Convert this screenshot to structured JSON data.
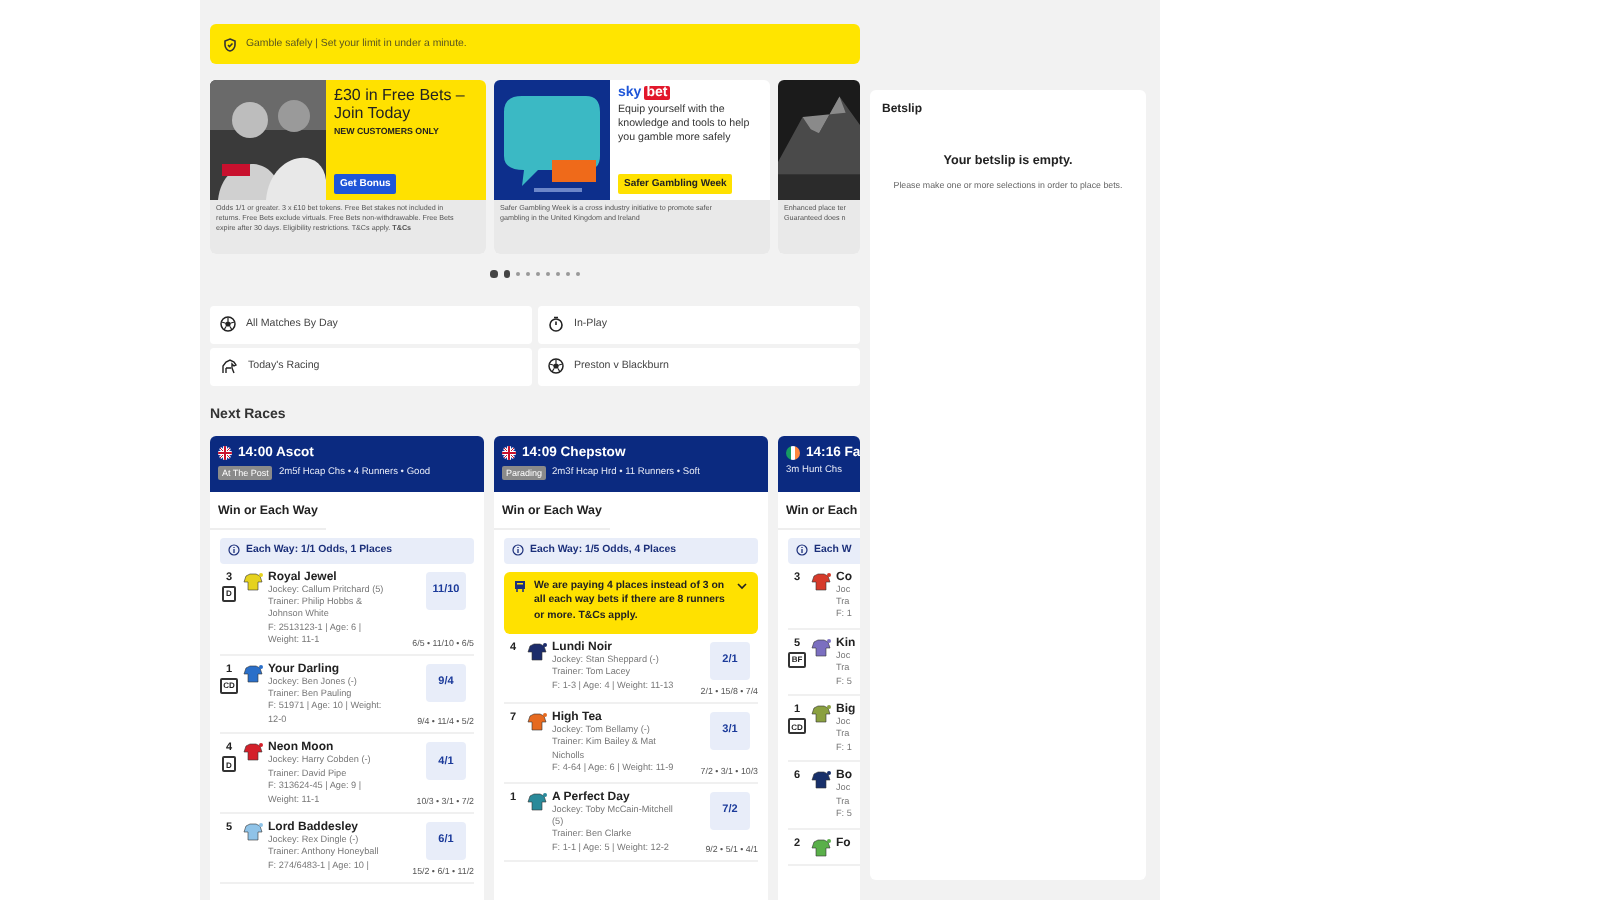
{
  "banner": {
    "text": "Gamble safely | Set your limit in under a minute."
  },
  "promos": [
    {
      "kind": "offer",
      "heading": "£30 in Free Bets – Join Today",
      "subheading": "NEW CUSTOMERS ONLY",
      "button": "Get Bonus",
      "footer": [
        "Odds 1/1 or greater. 3 x £10 bet tokens. Free Bet stakes not included in",
        "returns. Free Bets exclude virtuals. Free Bets non-withdrawable. Free Bets",
        "expire after 30 days. Eligibility restrictions. T&Cs apply. **T&Cs**"
      ]
    },
    {
      "kind": "info",
      "logo": {
        "first": "sky",
        "second": "bet"
      },
      "text": "Equip yourself with the knowledge and tools to help you gamble more safely",
      "button": "Safer Gambling Week",
      "footer": [
        "Safer Gambling Week is a cross industry initiative to promote safer",
        "gambling in the United Kingdom and Ireland"
      ]
    },
    {
      "footer": [
        "Enhanced place ter",
        "Guaranteed does n"
      ]
    }
  ],
  "carousel_dots": [
    {
      "selected": true
    },
    {
      "selected": true
    },
    {
      "selected": false
    },
    {
      "selected": false
    },
    {
      "selected": false
    },
    {
      "selected": false
    },
    {
      "selected": false
    },
    {
      "selected": false
    },
    {
      "selected": false
    }
  ],
  "quick_links": [
    {
      "kind": "ball",
      "label": "All Matches By Day"
    },
    {
      "kind": "stopwatch",
      "label": "In-Play"
    },
    {
      "kind": "horse",
      "label": "Today's Racing"
    },
    {
      "kind": "ball",
      "label": "Preston v Blackburn"
    }
  ],
  "next_races": {
    "title": "Next Races",
    "races": [
      {
        "kind": "uk",
        "title": "14:00 Ascot",
        "status": "At The Post",
        "info": "2m5f Hcap Chs • 4 Runners • Good",
        "market": "Win or Each Way",
        "each_way": "Each Way: 1/1 Odds, 1 Places",
        "runners": [
          {
            "number": "3",
            "badge": "D",
            "color": "#e6d21f",
            "name": "Royal Jewel",
            "jockey": "Jockey: Callum Pritchard (5)",
            "trainer": "Trainer: Philip Hobbs & Johnson White",
            "form": "F: 2513123-1 | Age: 6 | Weight: 11-1",
            "odds": "11/10",
            "history": "6/5 • 11/10 • 6/5"
          },
          {
            "number": "1",
            "badge": "CD",
            "color": "#2a6fc9",
            "name": "Your Darling",
            "jockey": "Jockey: Ben Jones (-)",
            "trainer": "Trainer: Ben Pauling",
            "form": "F: 51971 | Age: 10 | Weight: 12-0",
            "odds": "9/4",
            "history": "9/4 • 11/4 • 5/2"
          },
          {
            "number": "4",
            "badge": "D",
            "color": "#d4202a",
            "name": "Neon Moon",
            "jockey": "Jockey: Harry Cobden (-)",
            "trainer": "Trainer: David Pipe",
            "form": "F: 313624-45 | Age: 9 | Weight: 11-1",
            "odds": "4/1",
            "history": "10/3 • 3/1 • 7/2"
          },
          {
            "number": "5",
            "color": "#8fc3e8",
            "name": "Lord Baddesley",
            "jockey": "Jockey: Rex Dingle (-)",
            "trainer": "Trainer: Anthony Honeyball",
            "form": "F: 274/6483-1 | Age: 10 |",
            "odds": "6/1",
            "history": "15/2 • 6/1 • 11/2"
          }
        ]
      },
      {
        "kind": "uk",
        "title": "14:09 Chepstow",
        "status": "Parading",
        "info": "2m3f Hcap Hrd • 11 Runners • Soft",
        "market": "Win or Each Way",
        "each_way": "Each Way: 1/5 Odds, 4 Places",
        "notice": "We are paying 4 places instead of 3 on all each way bets if there are 8 runners or more. T&Cs apply.",
        "runners": [
          {
            "number": "4",
            "color": "#1c2c6b",
            "name": "Lundi Noir",
            "jockey": "Jockey: Stan Sheppard (-)",
            "trainer": "Trainer: Tom Lacey",
            "form": "F: 1-3 | Age: 4 | Weight: 11-13",
            "odds": "2/1",
            "history": "2/1 • 15/8 • 7/4"
          },
          {
            "number": "7",
            "color": "#e66a20",
            "name": "High Tea",
            "jockey": "Jockey: Tom Bellamy (-)",
            "trainer": "Trainer: Kim Bailey & Mat Nicholls",
            "form": "F: 4-64 | Age: 6 | Weight: 11-9",
            "odds": "3/1",
            "history": "7/2 • 3/1 • 10/3"
          },
          {
            "number": "1",
            "color": "#2a8a9a",
            "name": "A Perfect Day",
            "jockey": "Jockey: Toby McCain-Mitchell (5)",
            "trainer": "Trainer: Ben Clarke",
            "form": "F: 1-1 | Age: 5 | Weight: 12-2",
            "odds": "7/2",
            "history": "9/2 • 5/1 • 4/1"
          }
        ]
      },
      {
        "kind": "ie",
        "title": "14:16 Fa",
        "info": "3m Hunt Chs",
        "market": "Win or Each",
        "each_way": "Each W",
        "runners": [
          {
            "number": "3",
            "color": "#d63a2a",
            "name": "Co",
            "jockey": "Joc",
            "trainer": "Tra",
            "form": "F: 1"
          },
          {
            "number": "5",
            "badge": "BF",
            "color": "#7b6fc0",
            "name": "Kin",
            "jockey": "Joc",
            "trainer": "Tra",
            "form": "F: 5"
          },
          {
            "number": "1",
            "badge": "CD",
            "color": "#8aa040",
            "name": "Big",
            "jockey": "Joc",
            "trainer": "Tra",
            "form": "F: 1"
          },
          {
            "number": "6",
            "color": "#18306a",
            "name": "Bo",
            "jockey": "Joc",
            "trainer": "Tra",
            "form": "F: 5"
          },
          {
            "number": "2",
            "color": "#5ab04a",
            "name": "Fo"
          }
        ]
      }
    ]
  },
  "betslip": {
    "title": "Betslip",
    "empty_title": "Your betslip is empty.",
    "empty_text": "Please make one or more selections in order to place bets."
  }
}
